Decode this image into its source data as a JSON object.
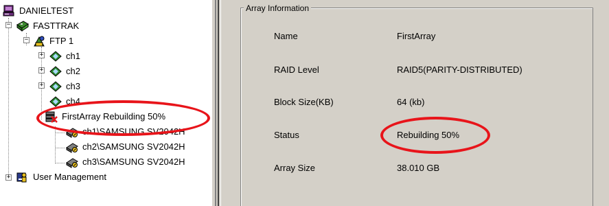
{
  "tree": {
    "root": "DANIELTEST",
    "controller": "FASTTRAK",
    "port": "FTP 1",
    "channels": [
      "ch1",
      "ch2",
      "ch3",
      "ch4"
    ],
    "array": "FirstArray Rebuilding 50%",
    "disks": [
      "ch1\\SAMSUNG SV2042H",
      "ch2\\SAMSUNG SV2042H",
      "ch3\\SAMSUNG SV2042H"
    ],
    "user_mgmt": "User Management"
  },
  "array_info": {
    "legend": "Array Information",
    "rows": [
      {
        "label": "Name",
        "value": "FirstArray"
      },
      {
        "label": "RAID Level",
        "value": "RAID5(PARITY-DISTRIBUTED)"
      },
      {
        "label": "Block Size(KB)",
        "value": "64 (kb)"
      },
      {
        "label": "Status",
        "value": "Rebuilding 50%"
      },
      {
        "label": "Array Size",
        "value": "38.010 GB"
      }
    ]
  },
  "colors": {
    "highlight": "#e8141a",
    "panel_bg": "#d4d0c8"
  },
  "icons": {
    "root": "computer-icon",
    "controller": "controller-card-icon",
    "port": "port-icon",
    "channel": "channel-icon",
    "array": "array-warning-icon",
    "disk": "disk-drive-icon",
    "users": "user-management-icon"
  }
}
